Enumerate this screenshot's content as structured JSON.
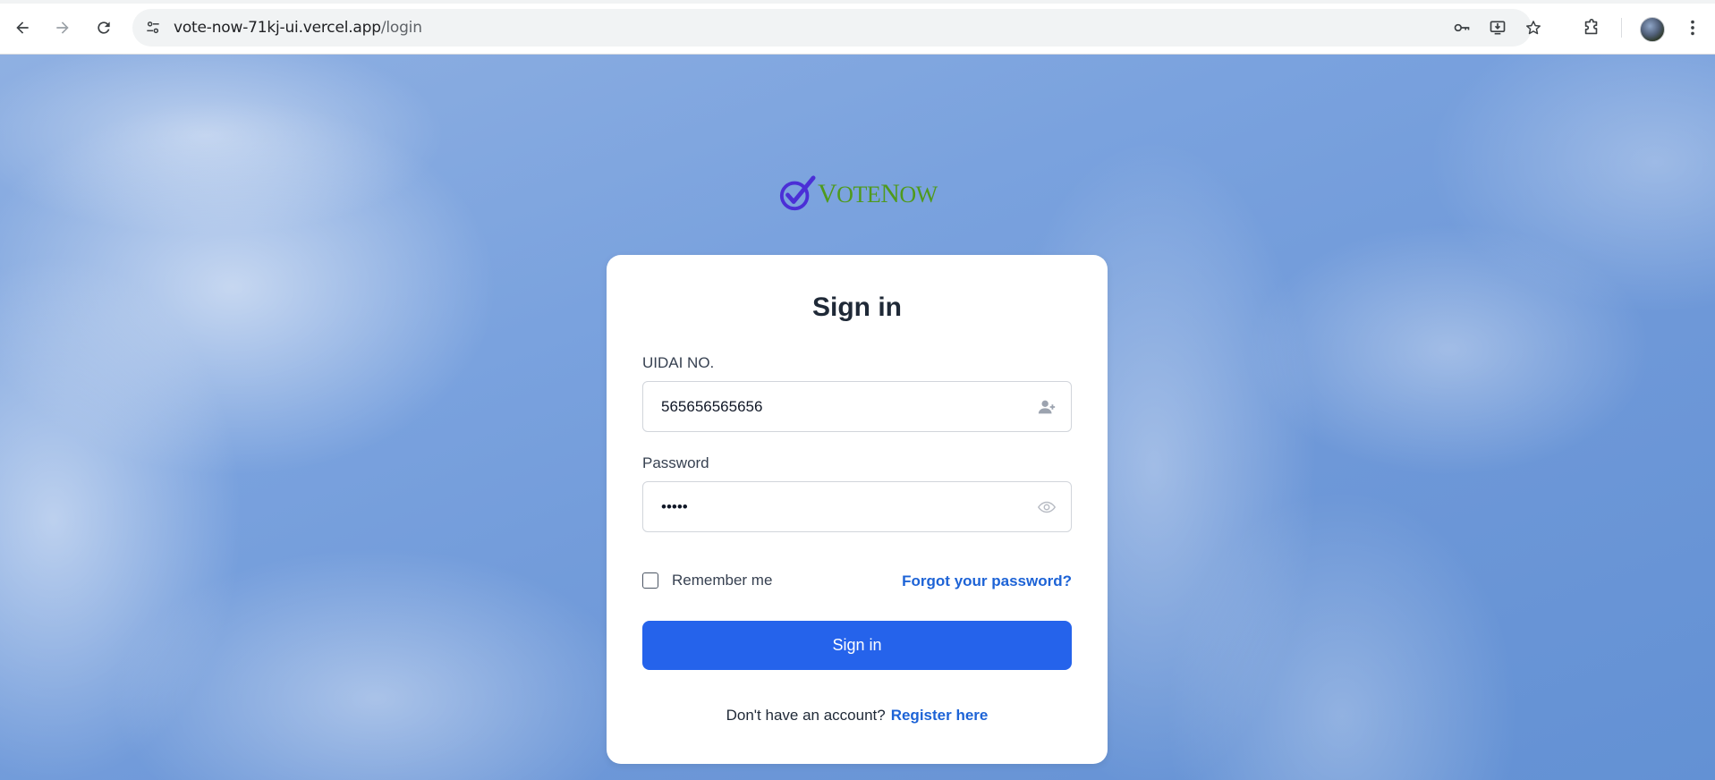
{
  "browser": {
    "url_host": "vote-now-71kj-ui.vercel.app",
    "url_path": "/login",
    "icons": {
      "back": "arrow-left-icon",
      "forward": "arrow-right-icon",
      "reload": "reload-icon",
      "site_info": "tune-icon",
      "password_manager": "key-icon",
      "install_app": "install-desktop-icon",
      "bookmark": "star-icon",
      "extensions": "puzzle-icon",
      "profile": "avatar",
      "menu": "more-vertical-icon"
    }
  },
  "logo": {
    "text_first": "V",
    "text_rest": "OTE",
    "text_second_cap": "N",
    "text_second_rest": "OW",
    "colors": {
      "check": "#4b2fd6",
      "text": "#4f9a1d"
    }
  },
  "form": {
    "title": "Sign in",
    "uidai_label": "UIDAI NO.",
    "uidai_value": "565656565656",
    "password_label": "Password",
    "password_value": "•••••",
    "remember_label": "Remember me",
    "remember_checked": false,
    "forgot_link": "Forgot your password?",
    "submit_label": "Sign in",
    "register_prompt": "Don't have an account?",
    "register_link": "Register here"
  },
  "colors": {
    "primary": "#2563eb",
    "link": "#1d63d6",
    "sky": "#7aa2de"
  }
}
